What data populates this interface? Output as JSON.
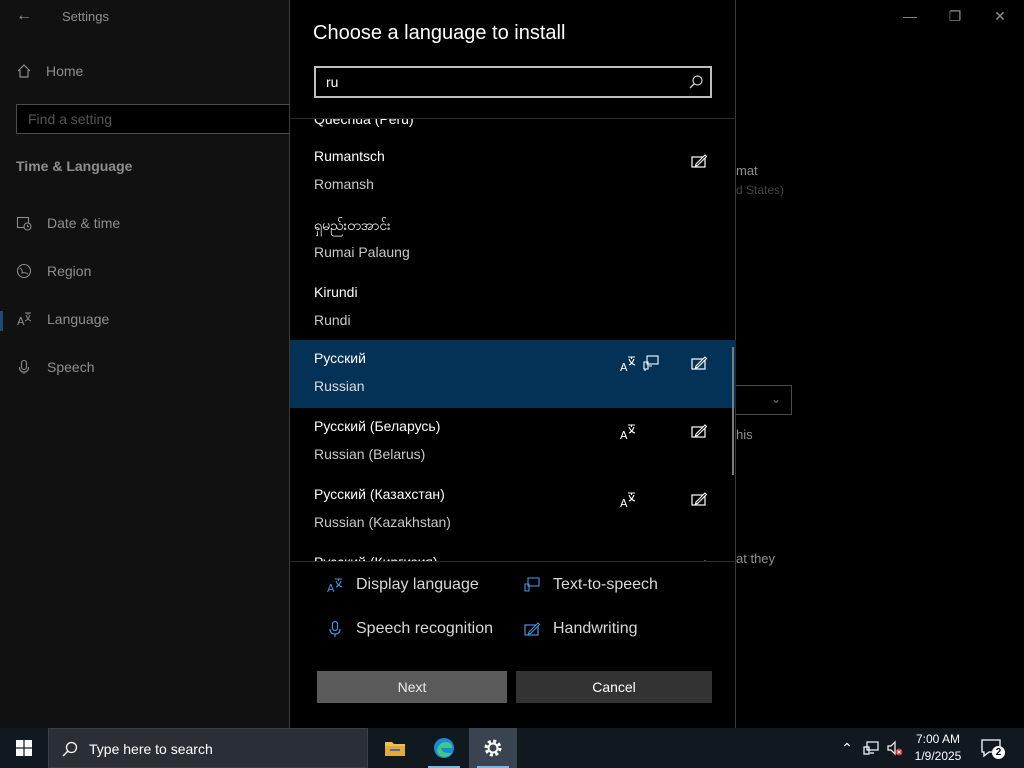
{
  "settings": {
    "title": "Settings",
    "home_label": "Home",
    "search_placeholder": "Find a setting",
    "section": "Time & Language",
    "nav": [
      {
        "label": "Date & time",
        "icon": "calendar-clock-icon"
      },
      {
        "label": "Region",
        "icon": "globe-icon"
      },
      {
        "label": "Language",
        "icon": "language-icon",
        "selected": true
      },
      {
        "label": "Speech",
        "icon": "microphone-icon"
      }
    ],
    "right_fragments": {
      "format": "mat",
      "states": "d States)",
      "this": "his",
      "they": "at they"
    }
  },
  "dialog": {
    "title": "Choose a language to install",
    "search_value": "ru",
    "languages": [
      {
        "native": "Quechua (Peru)",
        "english": "",
        "partial": true
      },
      {
        "native": "Rumantsch",
        "english": "Romansh",
        "features": [
          "handwriting"
        ]
      },
      {
        "native": "ရှမည်းတအာင်း",
        "english": "Rumai Palaung",
        "features": []
      },
      {
        "native": "Kirundi",
        "english": "Rundi",
        "features": []
      },
      {
        "native": "Русский",
        "english": "Russian",
        "features": [
          "display",
          "tts",
          "handwriting"
        ],
        "selected": true
      },
      {
        "native": "Русский (Беларусь)",
        "english": "Russian (Belarus)",
        "features": [
          "display",
          "handwriting"
        ]
      },
      {
        "native": "Русский (Казахстан)",
        "english": "Russian (Kazakhstan)",
        "features": [
          "display",
          "handwriting"
        ]
      },
      {
        "native": "Русский (Киргизия)",
        "english": "",
        "features": [
          "display",
          "handwriting"
        ],
        "partial": true
      }
    ],
    "legend": {
      "display": "Display language",
      "tts": "Text-to-speech",
      "speech": "Speech recognition",
      "handwriting": "Handwriting"
    },
    "next_label": "Next",
    "cancel_label": "Cancel"
  },
  "taskbar": {
    "search_placeholder": "Type here to search",
    "time": "7:00 AM",
    "date": "1/9/2025",
    "notification_count": "2"
  },
  "colors": {
    "accent": "#3b86d8",
    "selected_row": "#043257",
    "legend_icon": "#4a90e2"
  }
}
